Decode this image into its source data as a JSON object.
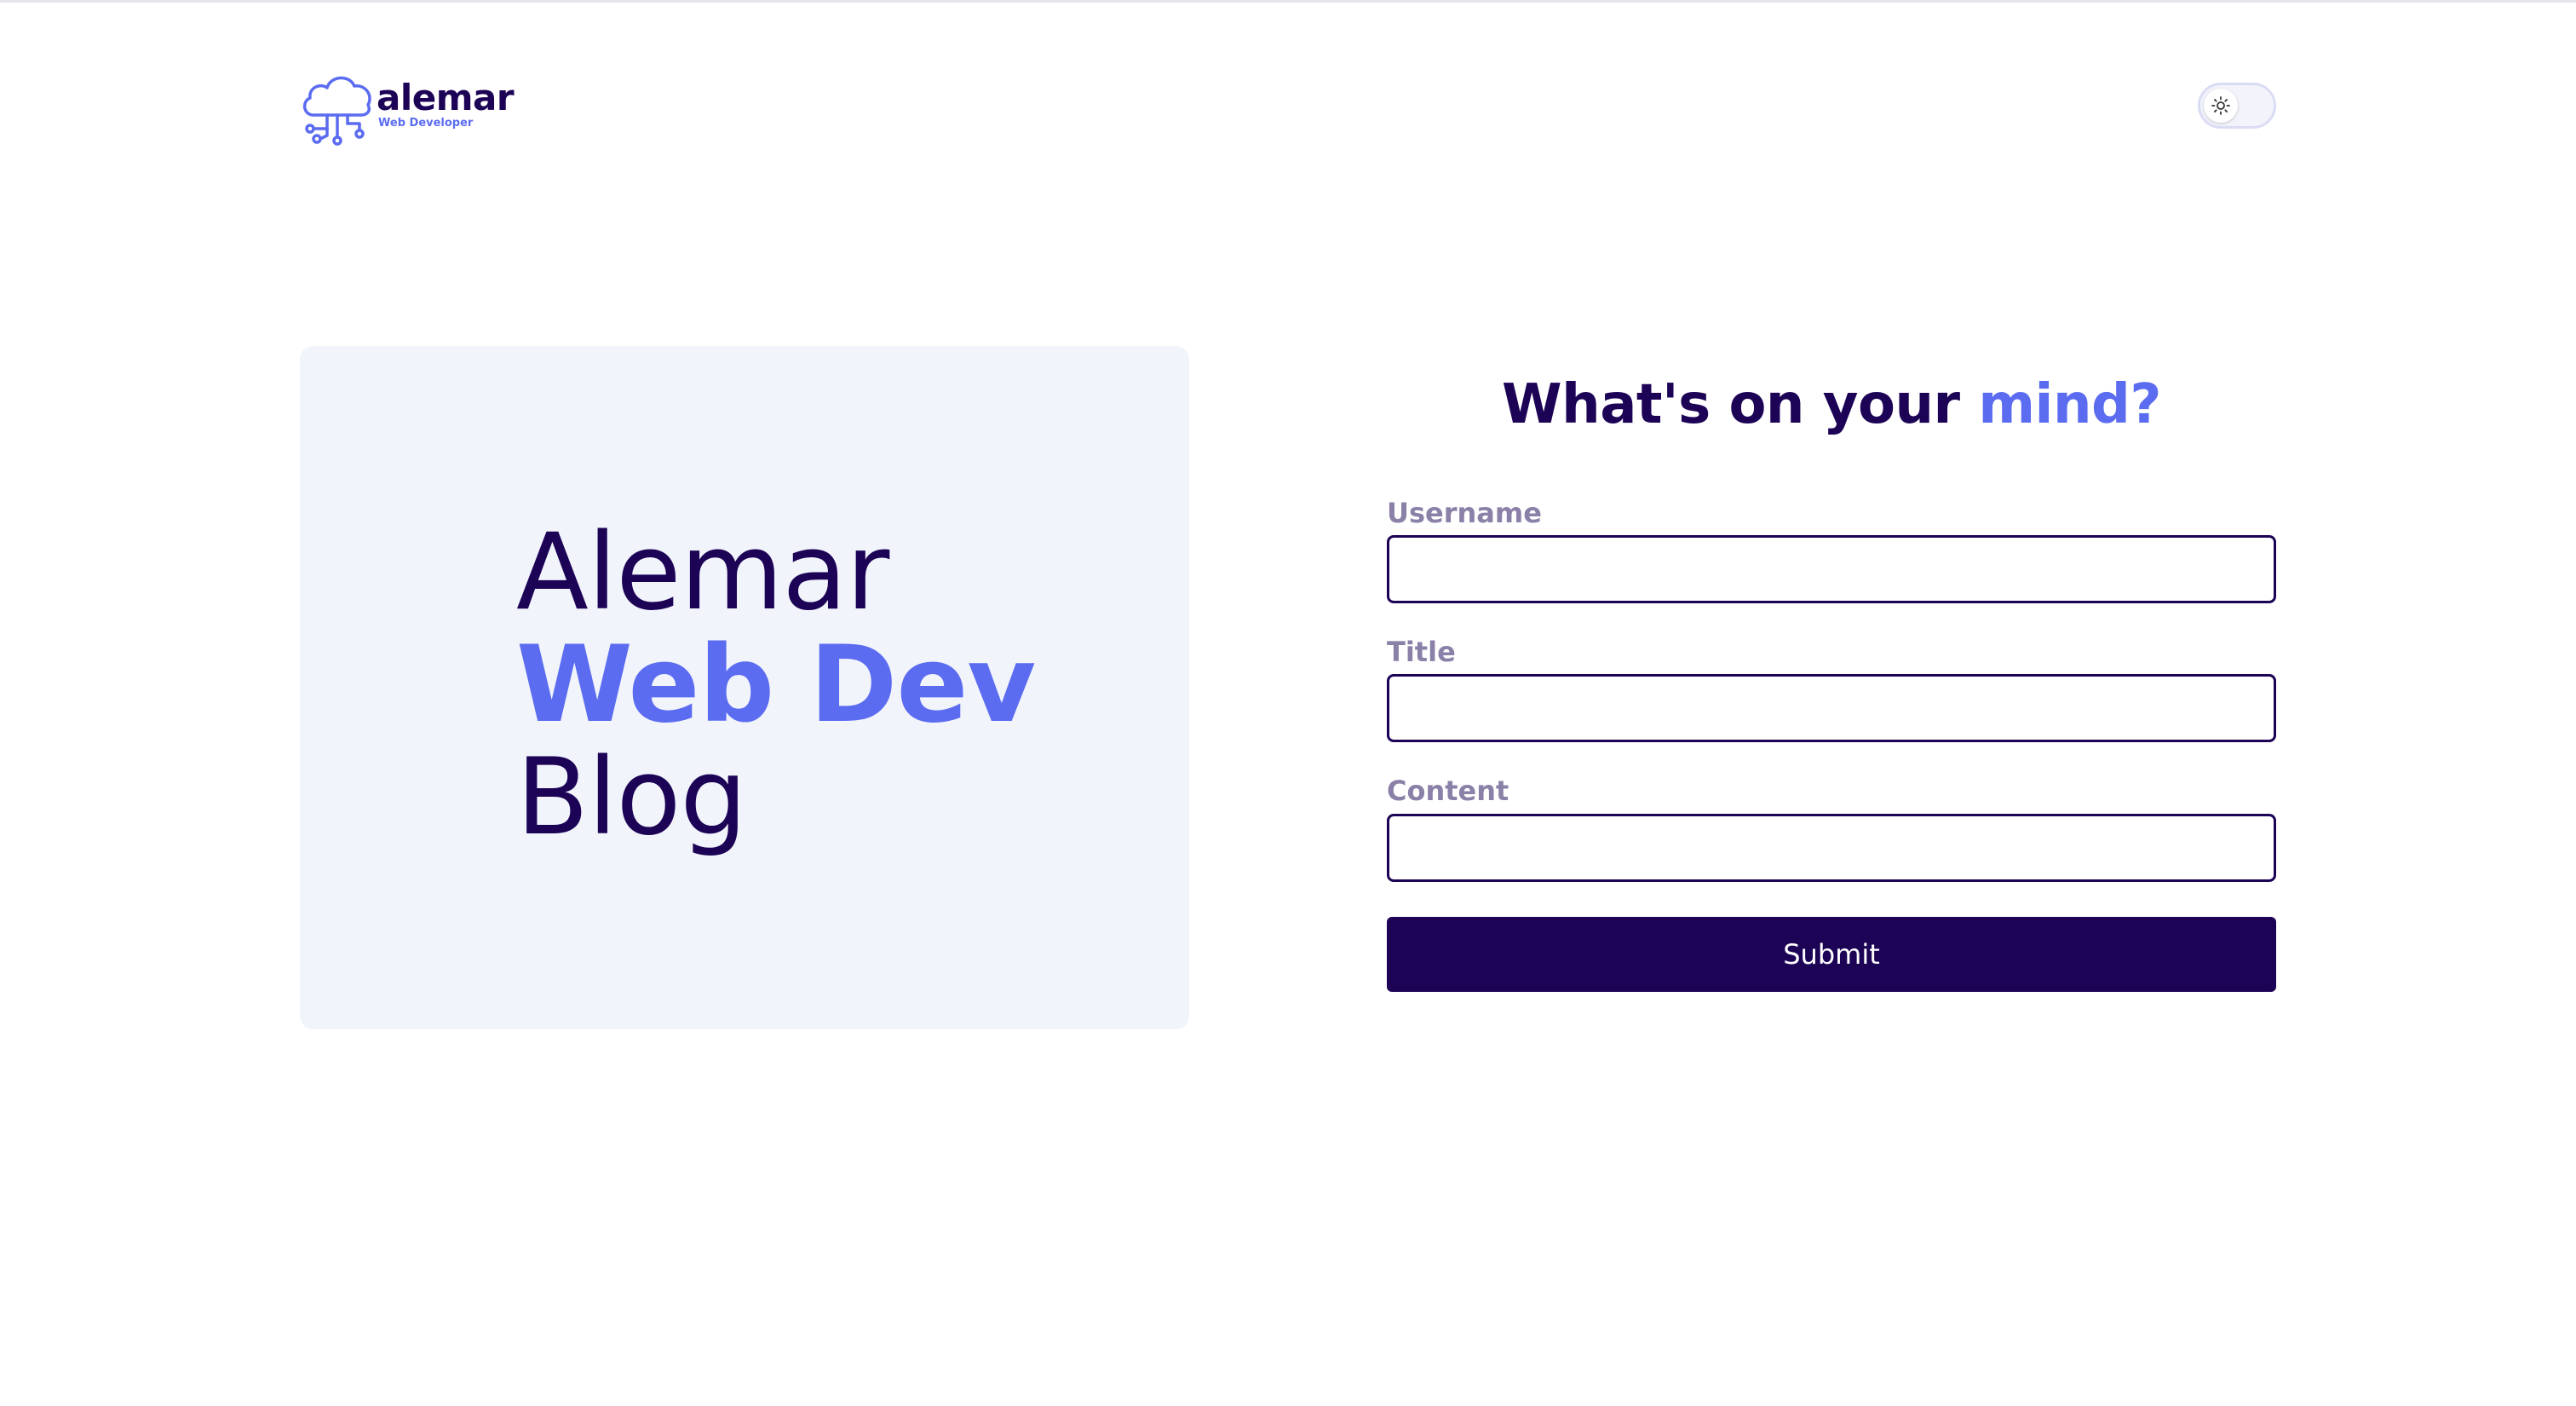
{
  "header": {
    "logo": {
      "name": "alemar",
      "tagline": "Web Developer",
      "icon": "cloud-circuit-icon"
    },
    "theme_toggle": {
      "icon": "sun-icon",
      "state": "light"
    }
  },
  "hero": {
    "line1": "Alemar",
    "line2": "Web Dev",
    "line3": "Blog"
  },
  "form": {
    "title_prefix": "What's on your",
    "title_accent": "mind?",
    "fields": [
      {
        "label": "Username",
        "value": "",
        "placeholder": ""
      },
      {
        "label": "Title",
        "value": "",
        "placeholder": ""
      },
      {
        "label": "Content",
        "value": "",
        "placeholder": ""
      }
    ],
    "submit_label": "Submit"
  },
  "colors": {
    "primary": "#1c0356",
    "accent": "#5b6cf0",
    "card_background": "#f2f4fc",
    "label": "#8a80a8"
  }
}
